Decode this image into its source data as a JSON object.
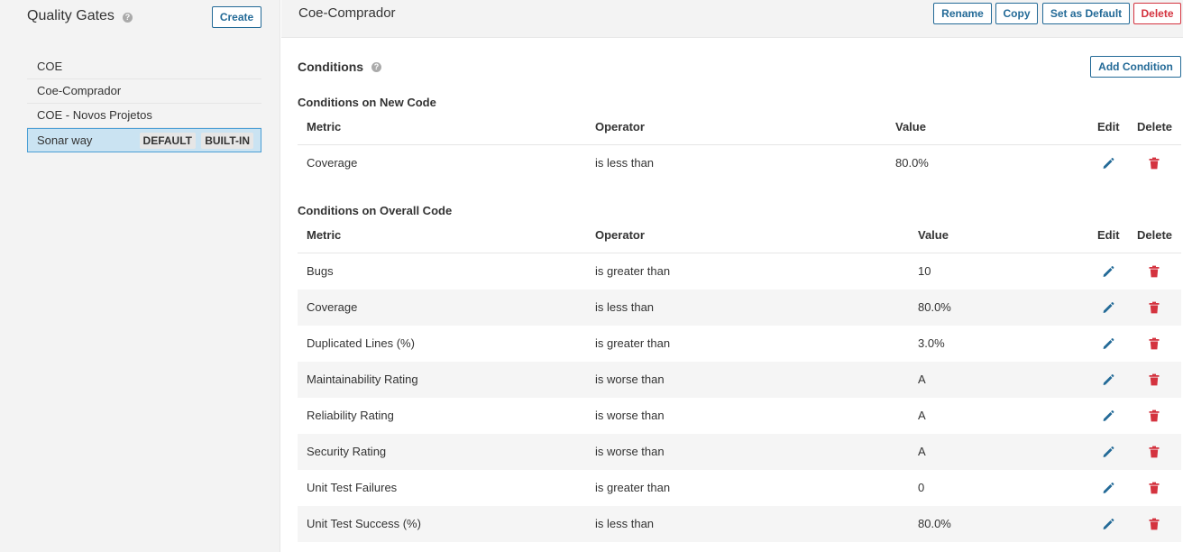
{
  "sidebar": {
    "title": "Quality Gates",
    "help_glyph": "?",
    "create_label": "Create",
    "items": [
      {
        "label": "COE"
      },
      {
        "label": "Coe-Comprador"
      },
      {
        "label": "COE - Novos Projetos"
      },
      {
        "label": "Sonar way",
        "tags": [
          "DEFAULT",
          "BUILT-IN"
        ],
        "selected": true
      }
    ]
  },
  "header": {
    "title": "Coe-Comprador",
    "rename_label": "Rename",
    "copy_label": "Copy",
    "set_default_label": "Set as Default",
    "delete_label": "Delete"
  },
  "conditions": {
    "title": "Conditions",
    "help_glyph": "?",
    "add_label": "Add Condition",
    "columns": {
      "metric": "Metric",
      "operator": "Operator",
      "value": "Value",
      "edit": "Edit",
      "delete": "Delete"
    },
    "new_code": {
      "title": "Conditions on New Code",
      "rows": [
        {
          "metric": "Coverage",
          "operator": "is less than",
          "value": "80.0%"
        }
      ]
    },
    "overall_code": {
      "title": "Conditions on Overall Code",
      "rows": [
        {
          "metric": "Bugs",
          "operator": "is greater than",
          "value": "10"
        },
        {
          "metric": "Coverage",
          "operator": "is less than",
          "value": "80.0%"
        },
        {
          "metric": "Duplicated Lines (%)",
          "operator": "is greater than",
          "value": "3.0%"
        },
        {
          "metric": "Maintainability Rating",
          "operator": "is worse than",
          "value": "A"
        },
        {
          "metric": "Reliability Rating",
          "operator": "is worse than",
          "value": "A"
        },
        {
          "metric": "Security Rating",
          "operator": "is worse than",
          "value": "A"
        },
        {
          "metric": "Unit Test Failures",
          "operator": "is greater than",
          "value": "0"
        },
        {
          "metric": "Unit Test Success (%)",
          "operator": "is less than",
          "value": "80.0%"
        }
      ]
    }
  },
  "icons": {
    "edit": "pencil-icon",
    "delete": "trash-icon"
  },
  "colors": {
    "accent": "#236a97",
    "danger": "#d4333f",
    "selected_bg": "#cae3f2",
    "selected_border": "#4b9fd5"
  }
}
